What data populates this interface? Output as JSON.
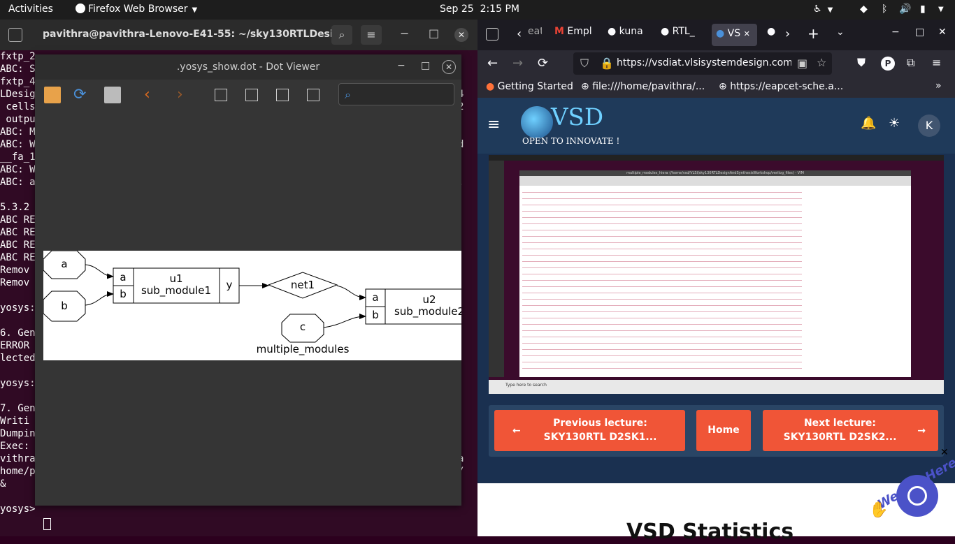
{
  "topbar": {
    "activities": "Activities",
    "app_menu": "Firefox Web Browser",
    "datetime_date": "Sep 25",
    "datetime_time": "2:15 PM"
  },
  "terminal": {
    "title": "pavithra@pavithra-Lenovo-E41-55: ~/sky130RTLDesig...",
    "lines": [
      "fxtp_2",
      "ABC: S",
      "fxtp_4",
      "LDesig",
      " cells",
      " outpu",
      "ABC: M",
      "ABC: W",
      "__fa_1",
      "ABC: W",
      "ABC: a",
      "",
      "5.3.2",
      "ABC RE",
      "ABC RE",
      "ABC RE",
      "ABC RE",
      "Remov",
      "Remov",
      "",
      "yosys:",
      "",
      "6. Gen",
      "ERROR",
      "lected",
      "",
      "yosys:",
      "",
      "7. Gen",
      "Writi",
      "Dumpin",
      "Exec:",
      "vithra",
      "home/p",
      "&",
      "",
      "yosys> "
    ],
    "right_chars": [
      "",
      "",
      "",
      "4",
      "2",
      "",
      "",
      "d",
      "",
      "",
      ".",
      "",
      "",
      "",
      "",
      "",
      "",
      "",
      "",
      "",
      "",
      "",
      "",
      "",
      "",
      "",
      "",
      "",
      "",
      "",
      "",
      "",
      "a",
      "/"
    ]
  },
  "dotviewer": {
    "title": ".yosys_show.dot - Dot Viewer",
    "graph": {
      "input_a": "a",
      "input_b": "b",
      "input_c": "c",
      "u1_port_a": "a",
      "u1_port_b": "b",
      "u1_name": "u1",
      "u1_type": "sub_module1",
      "u1_port_y": "y",
      "net1": "net1",
      "u2_port_a": "a",
      "u2_port_b": "b",
      "u2_name": "u2",
      "u2_type": "sub_module2",
      "module_name": "multiple_modules"
    }
  },
  "firefox": {
    "tabs": [
      "eat",
      "Empl",
      "kuna",
      "RTL_",
      "VS",
      ""
    ],
    "url": "https://vsdiat.vlsisystemdesign.com",
    "bookmarks": [
      "Getting Started",
      "file:///home/pavithra/...",
      "https://eapcet-sche.a..."
    ],
    "profile_initial": "P",
    "vsd_logo": "VSD",
    "vsd_tagline": "OPEN TO INNOVATE !",
    "avatar_initial": "K",
    "embedded_window_title": "multiple_modules_hiera (/home/vsd/VLSI/sky130RTLDesignAndSynthesisWorkshop/verilog_files) - VIM",
    "embedded_search": "Type here to search",
    "prev_button": "Previous lecture: SKY130RTL D2SK1...",
    "home_button": "Home",
    "next_button": "Next lecture: SKY130RTL D2SK2...",
    "chat_badge": "We Are Here!",
    "stats_heading": "VSD Statistics"
  },
  "colors": {
    "terminal_bg": "#300a24",
    "vsd_blue": "#1f3a5a",
    "accent_orange": "#f05537",
    "chat_purple": "#4b52c8"
  }
}
